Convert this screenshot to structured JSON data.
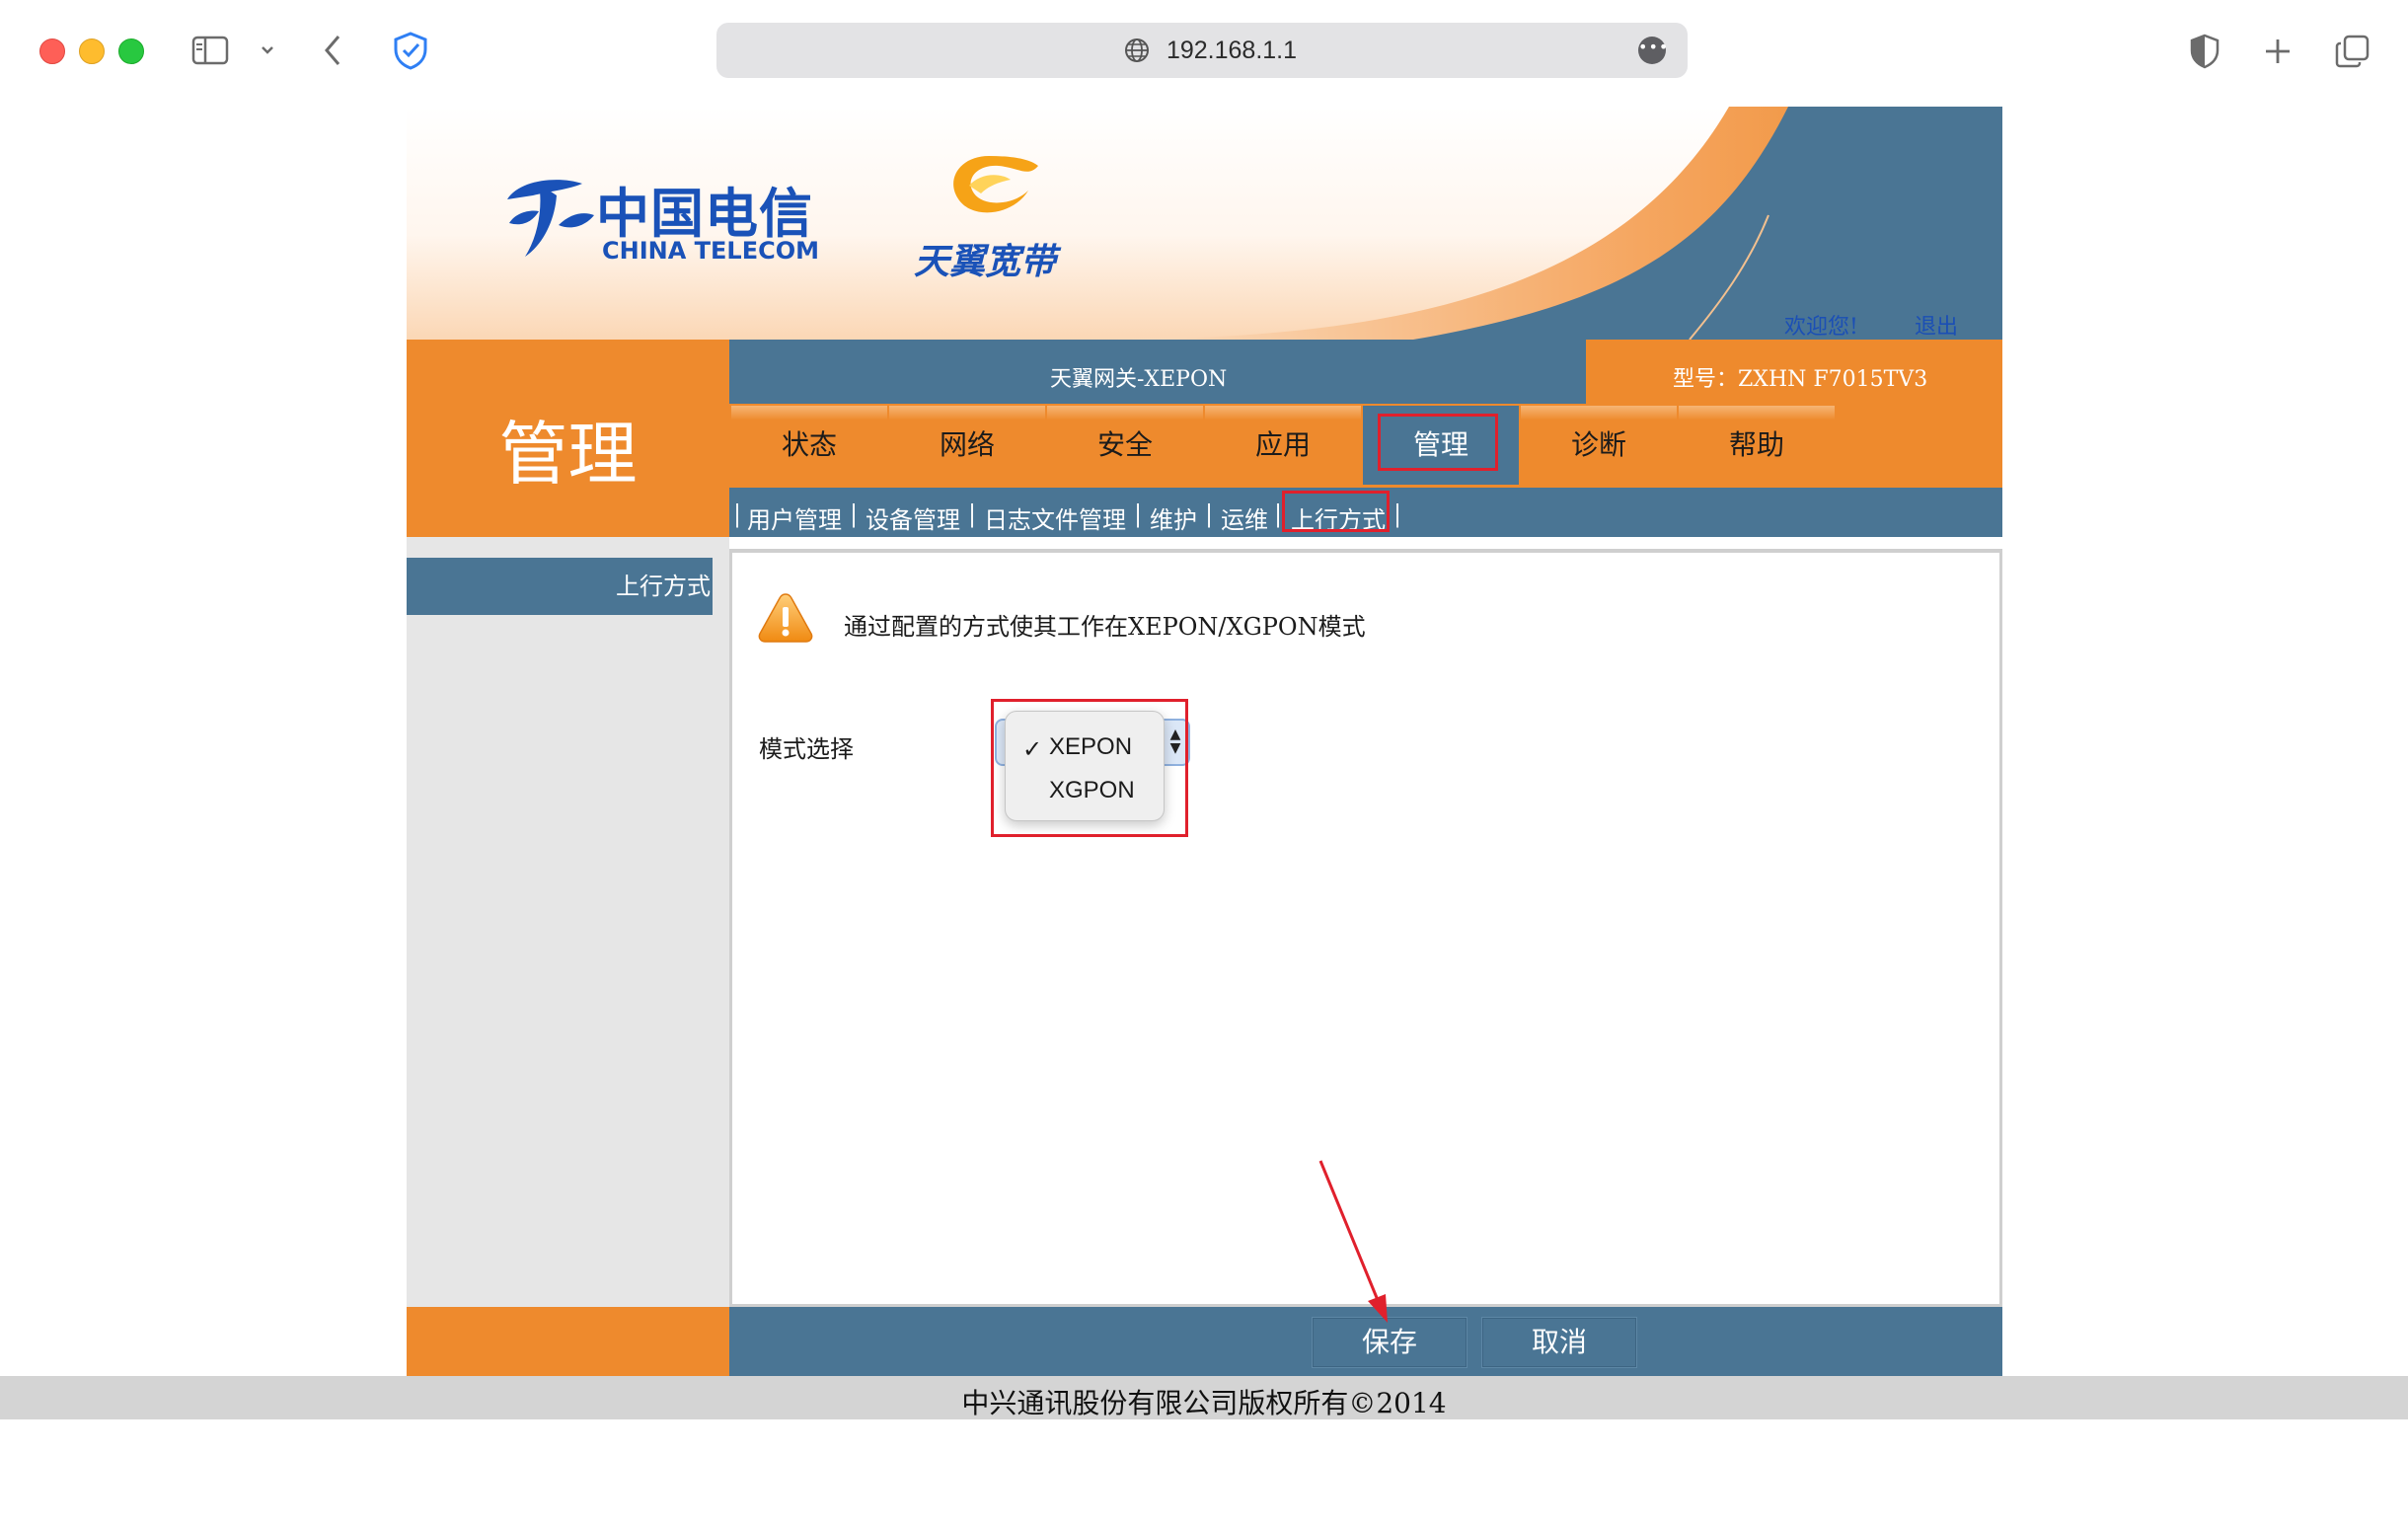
{
  "browser": {
    "url": "192.168.1.1"
  },
  "banner": {
    "logo_cn": "中国电信",
    "logo_en": "CHINA TELECOM",
    "brand_sub": "天翼宽带",
    "welcome": "欢迎您!",
    "logout": "退出"
  },
  "header": {
    "section_title": "管理",
    "gateway_name": "天翼网关-XEPON",
    "model": "型号：ZXHN F7015TV3"
  },
  "nav": {
    "tabs": [
      {
        "label": "状态"
      },
      {
        "label": "网络"
      },
      {
        "label": "安全"
      },
      {
        "label": "应用"
      },
      {
        "label": "管理"
      },
      {
        "label": "诊断"
      },
      {
        "label": "帮助"
      }
    ],
    "active_tab": "管理"
  },
  "subnav": {
    "items": [
      {
        "label": "用户管理"
      },
      {
        "label": "设备管理"
      },
      {
        "label": "日志文件管理"
      },
      {
        "label": "维护"
      },
      {
        "label": "运维"
      },
      {
        "label": "上行方式"
      }
    ],
    "separator": "|",
    "active": "上行方式"
  },
  "sidebar": {
    "items": [
      {
        "label": "上行方式"
      }
    ]
  },
  "content": {
    "notice": "通过配置的方式使其工作在XEPON/XGPON模式",
    "mode_label": "模式选择",
    "mode_options": [
      "XEPON",
      "XGPON"
    ],
    "mode_selected": "XEPON",
    "check_mark": "✓"
  },
  "actions": {
    "save_label": "保存",
    "cancel_label": "取消"
  },
  "footer": {
    "copyright": "中兴通讯股份有限公司版权所有©2014"
  },
  "colors": {
    "orange": "#ee8a2d",
    "steel_blue": "#4a7594",
    "highlight_red": "#e0202c"
  }
}
